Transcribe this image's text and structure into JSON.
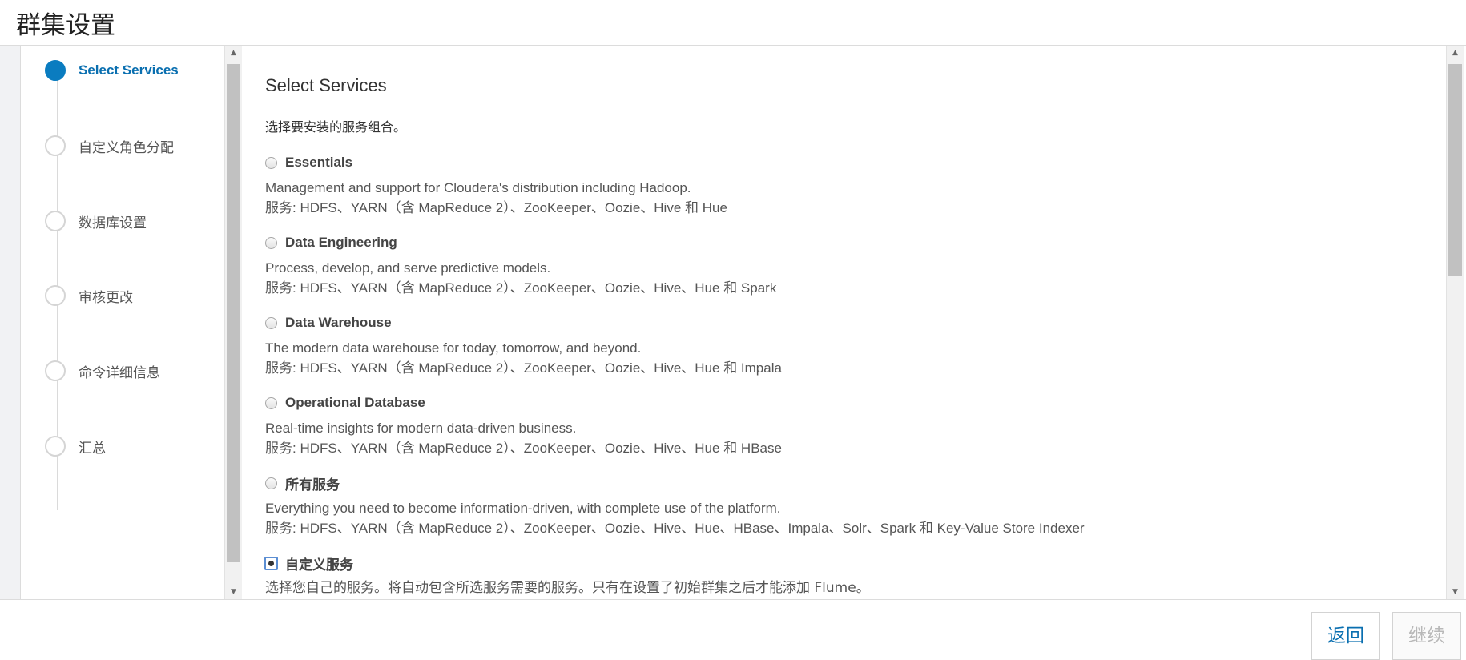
{
  "page": {
    "title": "群集设置"
  },
  "wizard": {
    "steps": [
      {
        "label": "Select Services",
        "active": true
      },
      {
        "label": "自定义角色分配",
        "active": false
      },
      {
        "label": "数据库设置",
        "active": false
      },
      {
        "label": "审核更改",
        "active": false
      },
      {
        "label": "命令详细信息",
        "active": false
      },
      {
        "label": "汇总",
        "active": false
      }
    ]
  },
  "content": {
    "heading": "Select Services",
    "intro": "选择要安装的服务组合。",
    "options": [
      {
        "name": "Essentials",
        "description": "Management and support for Cloudera's distribution including Hadoop.",
        "services": "服务: HDFS、YARN（含 MapReduce 2）、ZooKeeper、Oozie、Hive 和 Hue",
        "selected": false
      },
      {
        "name": "Data Engineering",
        "description": "Process, develop, and serve predictive models.",
        "services": "服务: HDFS、YARN（含 MapReduce 2）、ZooKeeper、Oozie、Hive、Hue 和 Spark",
        "selected": false
      },
      {
        "name": "Data Warehouse",
        "description": "The modern data warehouse for today, tomorrow, and beyond.",
        "services": "服务: HDFS、YARN（含 MapReduce 2）、ZooKeeper、Oozie、Hive、Hue 和 Impala",
        "selected": false
      },
      {
        "name": "Operational Database",
        "description": "Real-time insights for modern data-driven business.",
        "services": "服务: HDFS、YARN（含 MapReduce 2）、ZooKeeper、Oozie、Hive、Hue 和 HBase",
        "selected": false
      },
      {
        "name": "所有服务",
        "description": "Everything you need to become information-driven, with complete use of the platform.",
        "services": "服务: HDFS、YARN（含 MapReduce 2）、ZooKeeper、Oozie、Hive、Hue、HBase、Impala、Solr、Spark 和 Key-Value Store Indexer",
        "selected": false
      },
      {
        "name": "自定义服务",
        "description": "选择您自己的服务。将自动包含所选服务需要的服务。只有在设置了初始群集之后才能添加 Flume。",
        "services": "",
        "selected": true
      }
    ]
  },
  "footer": {
    "back_label": "返回",
    "continue_label": "继续"
  },
  "colors": {
    "accent": "#0a7cc0",
    "step_inactive": "#d5d5d5",
    "disabled_text": "#b8b8b8"
  },
  "icons": {
    "scroll_up": "triangle-up-icon",
    "scroll_down": "triangle-down-icon"
  }
}
